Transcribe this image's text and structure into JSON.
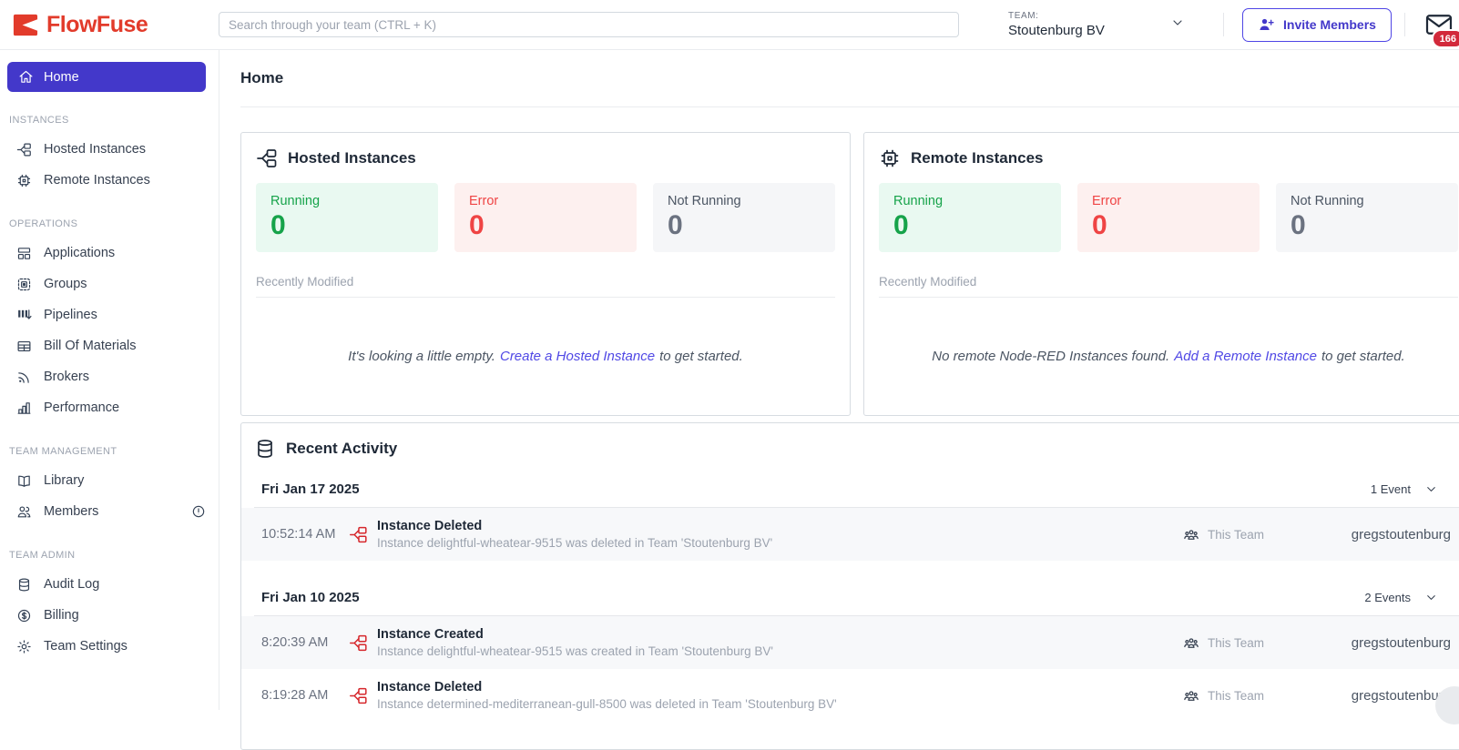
{
  "colors": {
    "brand_red": "#E23B2B",
    "accent_indigo": "#4338CA",
    "link_indigo": "#5048E5",
    "running_green": "#16A34A",
    "running_bg": "#E9F9F1",
    "error_red": "#EF4444",
    "error_bg": "#FDF0EF",
    "neutral_bg": "#F5F6F8",
    "badge_red": "#D2293B",
    "event_icon_red": "#D6272C"
  },
  "header": {
    "logo_text": "FlowFuse",
    "search_placeholder": "Search through your team (CTRL + K)",
    "team_label": "TEAM:",
    "team_name": "Stoutenburg BV",
    "invite_button_label": "Invite Members",
    "notification_count": "166"
  },
  "sidebar": {
    "home_label": "Home",
    "sections": [
      {
        "title": "INSTANCES",
        "items": [
          {
            "label": "Hosted Instances"
          },
          {
            "label": "Remote Instances"
          }
        ]
      },
      {
        "title": "OPERATIONS",
        "items": [
          {
            "label": "Applications"
          },
          {
            "label": "Groups"
          },
          {
            "label": "Pipelines"
          },
          {
            "label": "Bill Of Materials"
          },
          {
            "label": "Brokers"
          },
          {
            "label": "Performance"
          }
        ]
      },
      {
        "title": "TEAM MANAGEMENT",
        "items": [
          {
            "label": "Library"
          },
          {
            "label": "Members",
            "alert": true
          }
        ]
      },
      {
        "title": "TEAM ADMIN",
        "items": [
          {
            "label": "Audit Log"
          },
          {
            "label": "Billing"
          },
          {
            "label": "Team Settings"
          }
        ]
      }
    ]
  },
  "page": {
    "title": "Home"
  },
  "cards": {
    "hosted": {
      "title": "Hosted Instances",
      "stats": [
        {
          "label": "Running",
          "value": "0"
        },
        {
          "label": "Error",
          "value": "0"
        },
        {
          "label": "Not Running",
          "value": "0"
        }
      ],
      "recently_modified_label": "Recently Modified",
      "empty_prefix": "It's looking a little empty.",
      "empty_link": "Create a Hosted Instance",
      "empty_suffix": "to get started."
    },
    "remote": {
      "title": "Remote Instances",
      "stats": [
        {
          "label": "Running",
          "value": "0"
        },
        {
          "label": "Error",
          "value": "0"
        },
        {
          "label": "Not Running",
          "value": "0"
        }
      ],
      "recently_modified_label": "Recently Modified",
      "empty_prefix": "No remote Node-RED Instances found.",
      "empty_link": "Add a Remote Instance",
      "empty_suffix": "to get started."
    }
  },
  "activity": {
    "title": "Recent Activity",
    "groups": [
      {
        "date": "Fri Jan 17 2025",
        "count_label": "1 Event",
        "events": [
          {
            "time": "10:52:14 AM",
            "title": "Instance Deleted",
            "description": "Instance delightful-wheatear-9515 was deleted in Team 'Stoutenburg BV'",
            "scope": "This Team",
            "user": "gregstoutenburg"
          }
        ]
      },
      {
        "date": "Fri Jan 10 2025",
        "count_label": "2 Events",
        "events": [
          {
            "time": "8:20:39 AM",
            "title": "Instance Created",
            "description": "Instance delightful-wheatear-9515 was created in Team 'Stoutenburg BV'",
            "scope": "This Team",
            "user": "gregstoutenburg"
          },
          {
            "time": "8:19:28 AM",
            "title": "Instance Deleted",
            "description": "Instance determined-mediterranean-gull-8500 was deleted in Team 'Stoutenburg BV'",
            "scope": "This Team",
            "user": "gregstoutenburg"
          }
        ]
      }
    ]
  }
}
